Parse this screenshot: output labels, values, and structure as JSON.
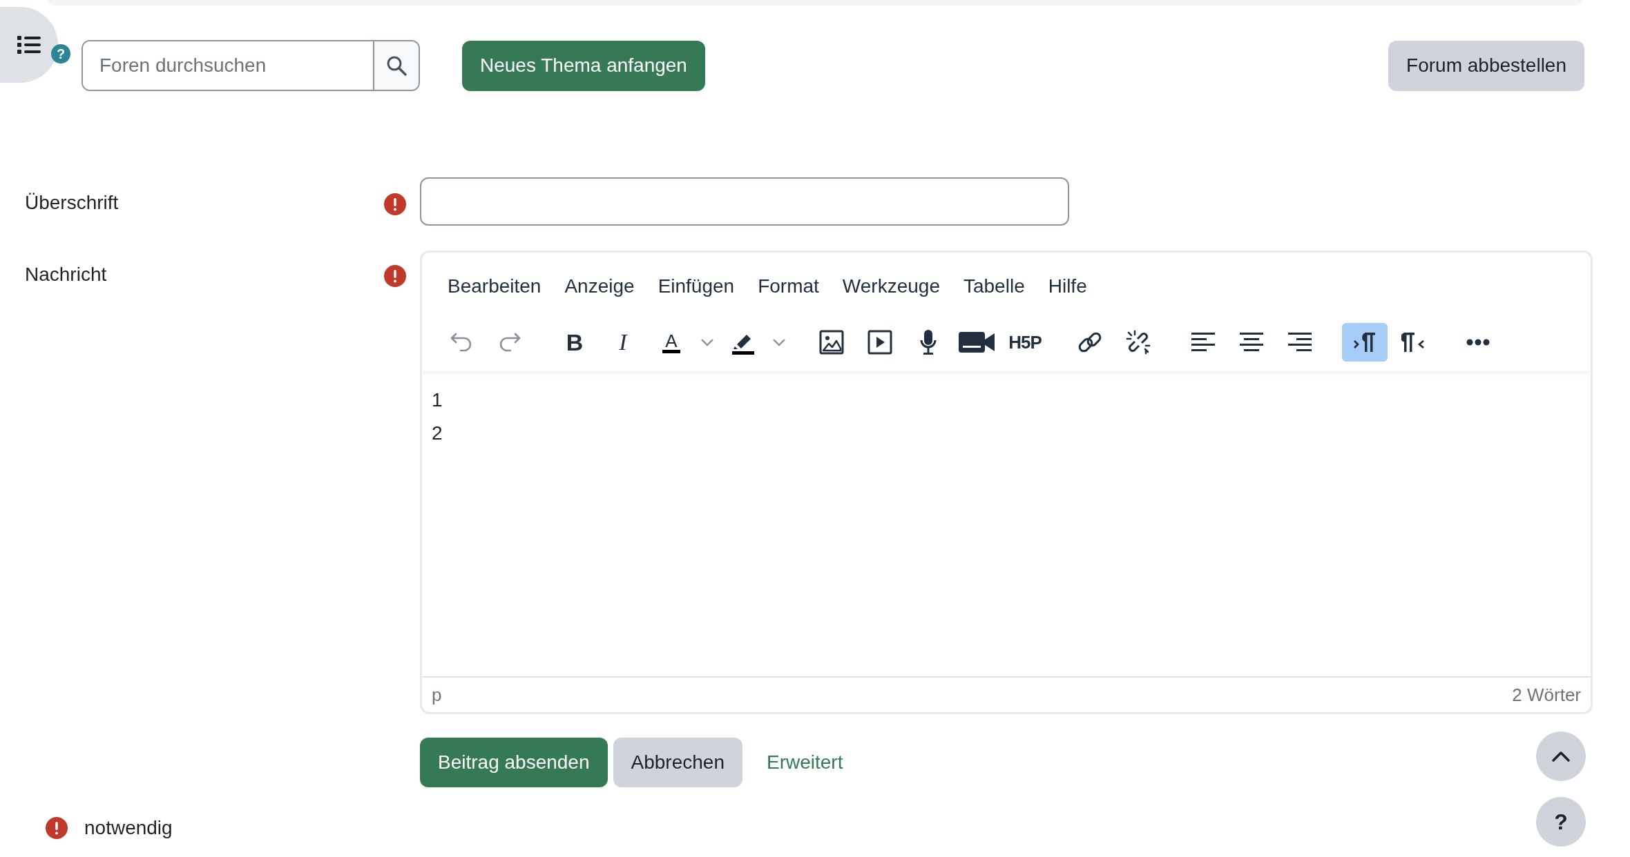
{
  "header": {
    "help_badge": "?",
    "search": {
      "placeholder": "Foren durchsuchen"
    },
    "new_topic_button": "Neues Thema anfangen",
    "unsubscribe_button": "Forum abbestellen"
  },
  "fields": [
    {
      "kind": "text",
      "label": "Überschrift",
      "required": true
    },
    {
      "kind": "editor",
      "label": "Nachricht",
      "required": true
    }
  ],
  "editor": {
    "menu": [
      "Bearbeiten",
      "Anzeige",
      "Einfügen",
      "Format",
      "Werkzeuge",
      "Tabelle",
      "Hilfe"
    ],
    "toolbar": [
      [
        {
          "disabled": true,
          "pressed": false,
          "dropdown": false
        },
        {
          "disabled": true,
          "pressed": false,
          "dropdown": false
        }
      ],
      [
        {
          "label": "B",
          "disabled": false,
          "pressed": false,
          "dropdown": false
        },
        {
          "label": "I",
          "disabled": false,
          "pressed": false,
          "dropdown": false
        },
        {
          "label": "A",
          "disabled": false,
          "pressed": false,
          "dropdown": true
        },
        {
          "disabled": false,
          "pressed": false,
          "dropdown": true
        }
      ],
      [
        {
          "disabled": false,
          "pressed": false,
          "dropdown": false
        },
        {
          "disabled": false,
          "pressed": false,
          "dropdown": false
        },
        {
          "disabled": false,
          "pressed": false,
          "dropdown": false
        },
        {
          "disabled": false,
          "pressed": false,
          "dropdown": false
        },
        {
          "label": "H5P",
          "disabled": false,
          "pressed": false,
          "dropdown": false
        }
      ],
      [
        {
          "disabled": false,
          "pressed": false,
          "dropdown": false
        },
        {
          "disabled": false,
          "pressed": false,
          "dropdown": false
        }
      ],
      [
        {
          "disabled": false,
          "pressed": false,
          "dropdown": false
        },
        {
          "disabled": false,
          "pressed": false,
          "dropdown": false
        },
        {
          "disabled": false,
          "pressed": false,
          "dropdown": false
        }
      ],
      [
        {
          "disabled": false,
          "pressed": true,
          "dropdown": false
        },
        {
          "disabled": false,
          "pressed": false,
          "dropdown": false
        }
      ],
      [
        {
          "disabled": false,
          "pressed": false,
          "dropdown": false
        }
      ]
    ],
    "lines": [
      "1",
      "2"
    ],
    "status_path": "p",
    "word_count": "2 Wörter"
  },
  "actions": {
    "submit": "Beitrag absenden",
    "cancel": "Abbrechen",
    "advanced": "Erweitert"
  },
  "required_note": "notwendig",
  "floating": {
    "help": "?"
  }
}
